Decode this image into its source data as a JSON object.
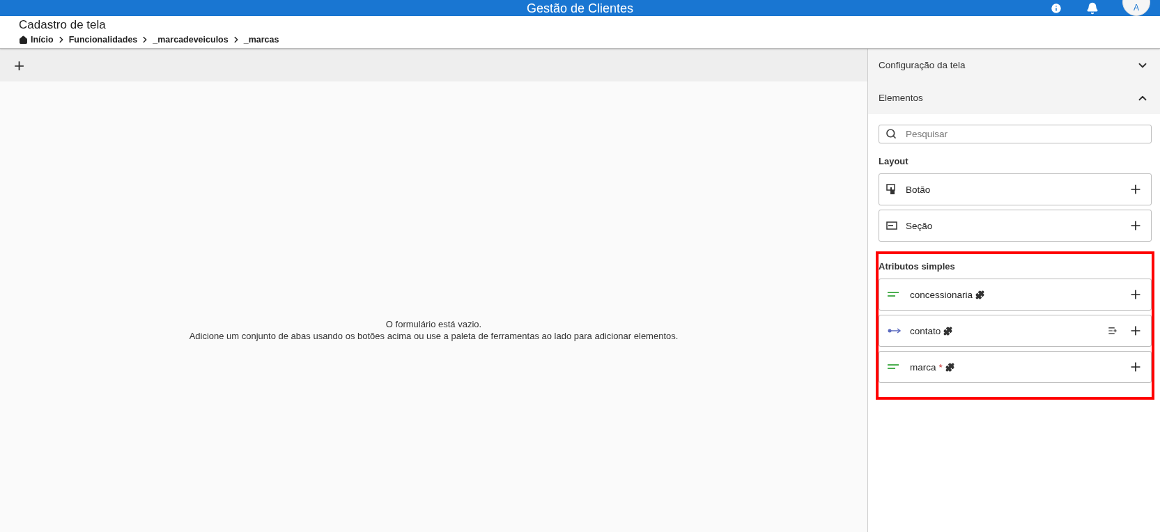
{
  "app_bar": {
    "title": "Gestão de Clientes",
    "avatar": "A"
  },
  "page": {
    "title": "Cadastro de tela",
    "breadcrumb": [
      "Início",
      "Funcionalidades",
      "_marcadeveiculos",
      "_marcas"
    ]
  },
  "form": {
    "toolbar_add": "+",
    "empty_title": "O formulário está vazio.",
    "empty_hint": "Adicione um conjunto de abas usando os botões acima ou use a paleta de ferramentas ao lado para adicionar elementos."
  },
  "side_panel": {
    "sections": [
      {
        "label": "Configuração da tela",
        "expanded": false
      },
      {
        "label": "Elementos",
        "expanded": true
      }
    ],
    "search": {
      "placeholder": "Pesquisar"
    },
    "layout_group": {
      "title": "Layout",
      "items": [
        {
          "kind": "button",
          "label": "Botão"
        },
        {
          "kind": "section",
          "label": "Seção"
        }
      ]
    },
    "attributes_group": {
      "title": "Atributos simples",
      "highlighted": true,
      "items": [
        {
          "kind": "text",
          "label": "concessionaria",
          "list_action": false
        },
        {
          "kind": "relation",
          "label": "contato",
          "list_action": true
        },
        {
          "kind": "text",
          "label": "marca",
          "required_mark": "*",
          "list_action": false
        }
      ]
    }
  }
}
